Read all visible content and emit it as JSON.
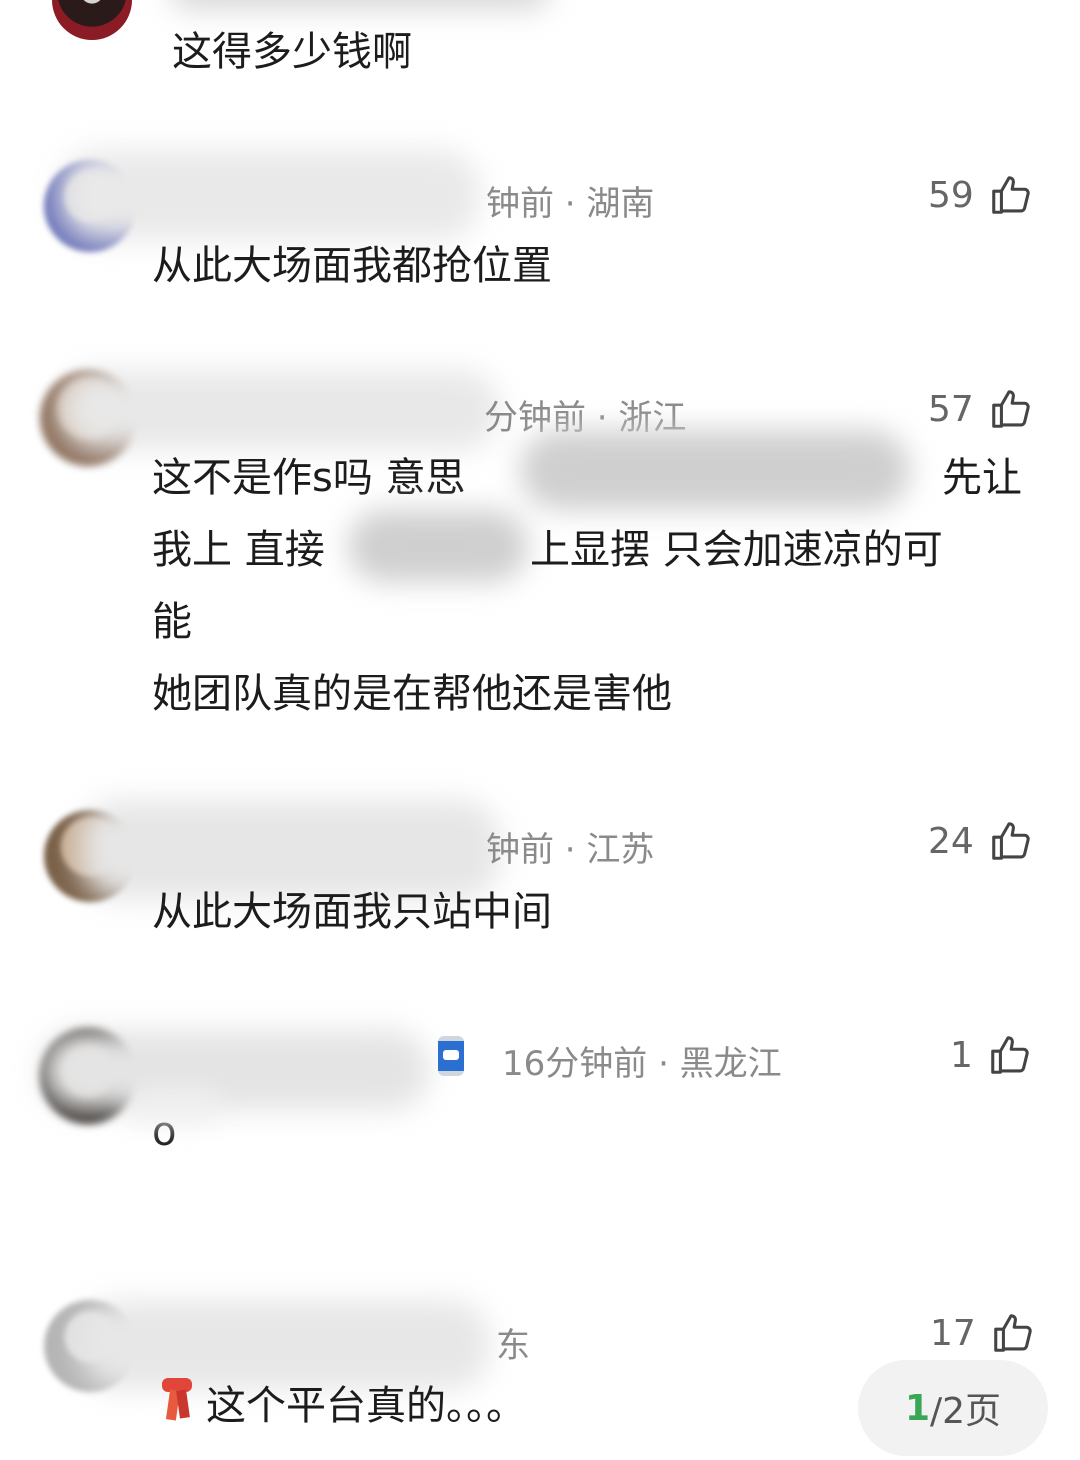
{
  "comments": [
    {
      "content": "这得多少钱啊"
    },
    {
      "meta": "钟前 · 湖南",
      "likes": "59",
      "content": "从此大场面我都抢位置"
    },
    {
      "meta": "分钟前 · 浙江",
      "likes": "57",
      "lines": [
        "这不是作s吗  意思",
        "先让",
        "我上   直接",
        "上显摆  只会加速凉的可",
        "能",
        "她团队真的是在帮他还是害他"
      ]
    },
    {
      "meta": "钟前 · 江苏",
      "likes": "24",
      "content": "从此大场面我只站中间"
    },
    {
      "meta": "16分钟前 · 黑龙江",
      "likes": "1",
      "content": "o",
      "badge_icon": "can-badge-icon"
    },
    {
      "meta": "东",
      "likes": "17",
      "content": "这个平台真的。。。",
      "emoji_icon": "scarf-icon"
    }
  ],
  "pager": {
    "current": "1",
    "rest": "/2页"
  },
  "colors": {
    "accent": "#3aa757",
    "meta": "#8a8a8a"
  }
}
